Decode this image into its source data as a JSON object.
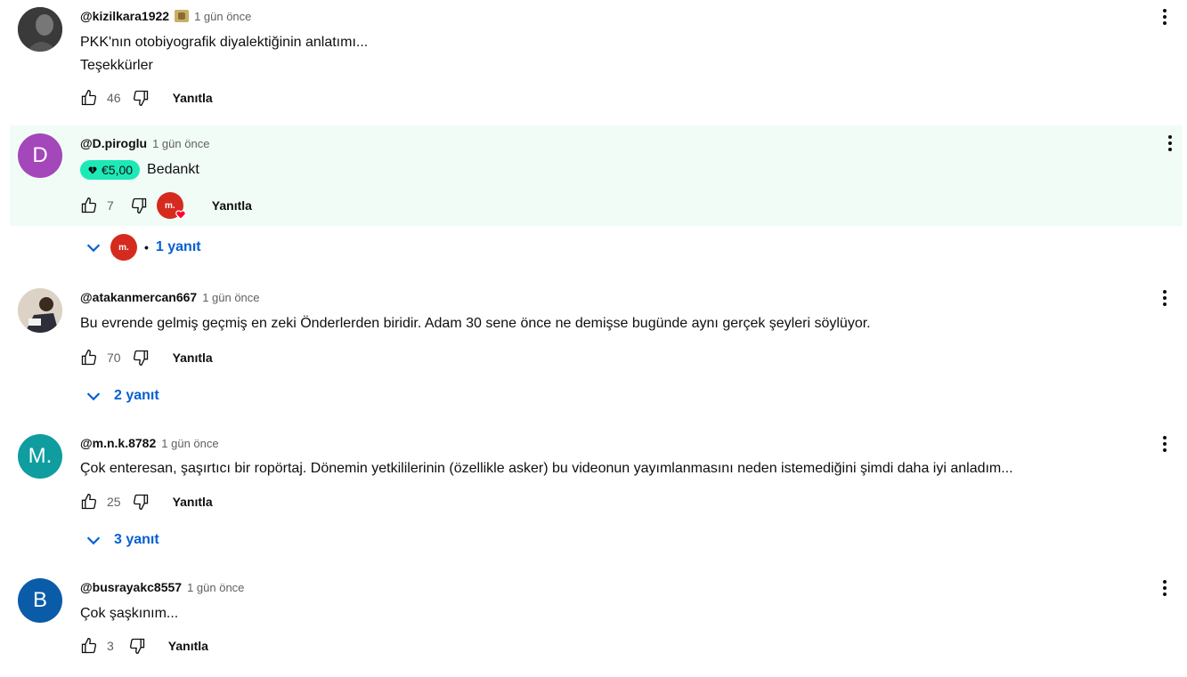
{
  "comments": [
    {
      "author": "@kizilkara1922",
      "time": "1 gün önce",
      "text_lines": [
        "PKK'nın otobiyografik diyalektiğinin anlatımı...",
        "Teşekkürler"
      ],
      "likes": "46",
      "reply_label": "Yanıtla"
    },
    {
      "author": "@D.piroglu",
      "avatar_letter": "D",
      "avatar_color": "#a347ba",
      "time": "1 gün önce",
      "superthanks": "€5,00",
      "text": "Bedankt",
      "likes": "7",
      "reply_label": "Yanıtla",
      "replies_label": "1 yanıt",
      "creator_mark": "m."
    },
    {
      "author": "@atakanmercan667",
      "time": "1 gün önce",
      "text": "Bu evrende gelmiş geçmiş en zeki Önderlerden biridir. Adam 30 sene önce ne demişse bugünde aynı gerçek şeyleri söylüyor.",
      "likes": "70",
      "reply_label": "Yanıtla",
      "replies_label": "2 yanıt"
    },
    {
      "author": "@m.n.k.8782",
      "avatar_letter": "M.",
      "avatar_color": "#0f9d9f",
      "time": "1 gün önce",
      "text": "Çok enteresan, şaşırtıcı bir ropörtaj. Dönemin yetkililerinin (özellikle asker) bu videonun yayımlanmasını neden istemediğini şimdi daha iyi anladım...",
      "likes": "25",
      "reply_label": "Yanıtla",
      "replies_label": "3 yanıt"
    },
    {
      "author": "@busrayakc8557",
      "avatar_letter": "B",
      "avatar_color": "#0a5ca8",
      "time": "1 gün önce",
      "text": "Çok şaşkınım...",
      "likes": "3",
      "reply_label": "Yanıtla"
    }
  ],
  "colors": {
    "link_blue": "#065fd4",
    "highlight_bg": "#f1fcf7",
    "superthanks_green": "#1de9b6",
    "creator_red": "#d52b1e"
  }
}
